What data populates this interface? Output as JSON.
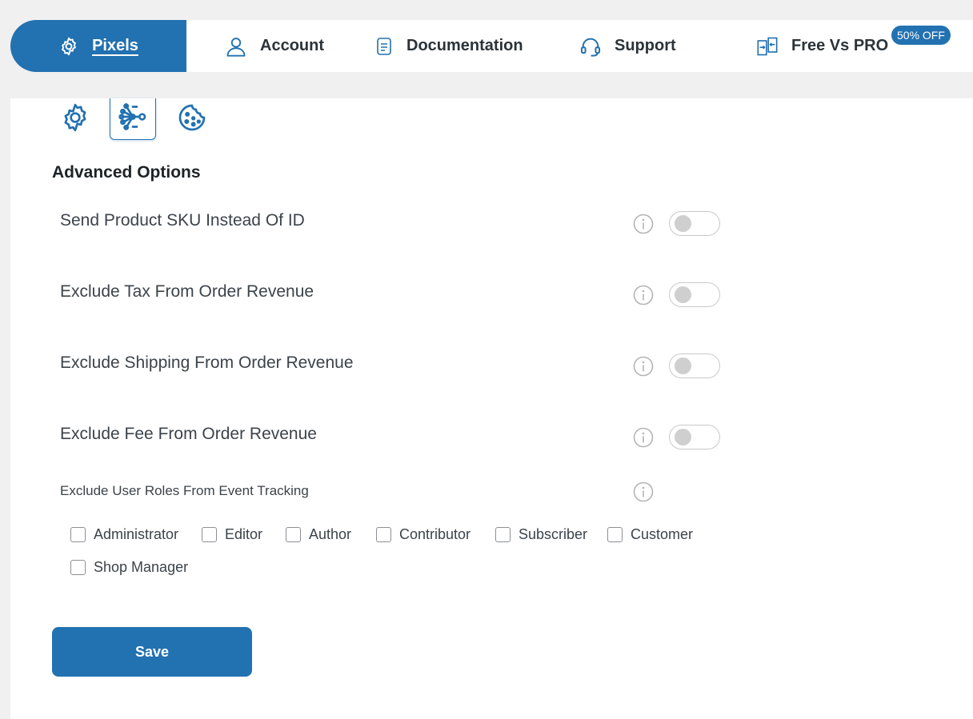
{
  "nav": {
    "tabs": [
      {
        "label": "Pixels",
        "icon": "gear-icon",
        "active": true
      },
      {
        "label": "Account",
        "icon": "user-icon"
      },
      {
        "label": "Documentation",
        "icon": "document-icon"
      },
      {
        "label": "Support",
        "icon": "headset-icon"
      },
      {
        "label": "Free Vs PRO",
        "icon": "compare-icon"
      }
    ],
    "badge": "50% OFF"
  },
  "subtabs": [
    {
      "icon": "gear-icon"
    },
    {
      "icon": "network-icon",
      "active": true
    },
    {
      "icon": "cookie-icon"
    }
  ],
  "section_title": "Advanced Options",
  "options": [
    {
      "label": "Send Product SKU Instead Of ID",
      "enabled": false
    },
    {
      "label": "Exclude Tax From Order Revenue",
      "enabled": false
    },
    {
      "label": "Exclude Shipping From Order Revenue",
      "enabled": false
    },
    {
      "label": "Exclude Fee From Order Revenue",
      "enabled": false
    }
  ],
  "user_roles": {
    "label": "Exclude User Roles From Event Tracking",
    "roles": [
      {
        "label": "Administrator",
        "checked": false
      },
      {
        "label": "Editor",
        "checked": false
      },
      {
        "label": "Author",
        "checked": false
      },
      {
        "label": "Contributor",
        "checked": false
      },
      {
        "label": "Subscriber",
        "checked": false
      },
      {
        "label": "Customer",
        "checked": false
      },
      {
        "label": "Shop Manager",
        "checked": false
      }
    ]
  },
  "save_label": "Save",
  "colors": {
    "accent": "#2271b1",
    "toggle_off_knob": "#cfcfcf",
    "info_icon": "#b4b4b4"
  }
}
